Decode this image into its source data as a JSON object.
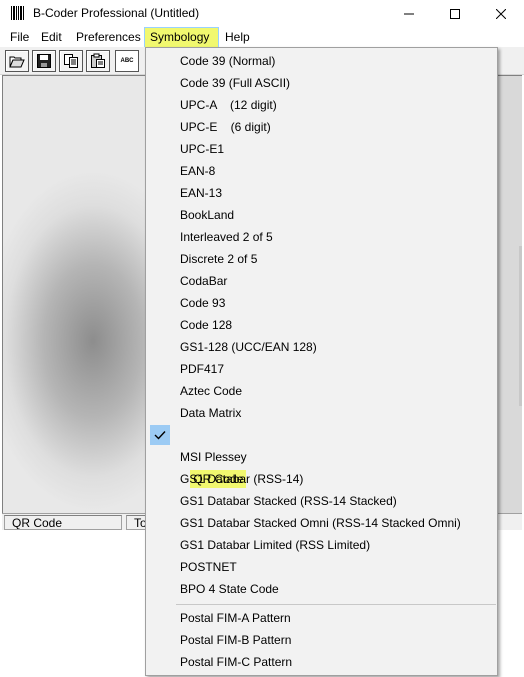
{
  "window": {
    "title": "B-Coder Professional (Untitled)",
    "icon": "barcode-icon"
  },
  "menubar": {
    "items": [
      {
        "label": "File"
      },
      {
        "label": "Edit"
      },
      {
        "label": "Preferences"
      },
      {
        "label": "Symbology",
        "active": true
      },
      {
        "label": "Help"
      }
    ]
  },
  "toolbar": {
    "buttons": [
      "open-icon",
      "save-icon",
      "copy-icon",
      "paste-icon"
    ],
    "text_button_label": "ABC"
  },
  "statusbar": {
    "symbology": "QR Code",
    "second": "To"
  },
  "symbology_menu": {
    "items": [
      {
        "label": "Code 39 (Normal)"
      },
      {
        "label": "Code 39 (Full ASCII)"
      },
      {
        "label": "UPC-A    (12 digit)"
      },
      {
        "label": "UPC-E    (6 digit)"
      },
      {
        "label": "UPC-E1"
      },
      {
        "label": "EAN-8"
      },
      {
        "label": "EAN-13"
      },
      {
        "label": "BookLand"
      },
      {
        "label": "Interleaved 2 of 5"
      },
      {
        "label": "Discrete 2 of 5"
      },
      {
        "label": "CodaBar"
      },
      {
        "label": "Code 93"
      },
      {
        "label": "Code 128"
      },
      {
        "label": "GS1-128 (UCC/EAN 128)"
      },
      {
        "label": "PDF417"
      },
      {
        "label": "Aztec Code"
      },
      {
        "label": "Data Matrix"
      },
      {
        "label": "QR Code",
        "checked": true
      },
      {
        "label": "MSI Plessey"
      },
      {
        "label": "GS1 Databar (RSS-14)"
      },
      {
        "label": "GS1 Databar Stacked (RSS-14 Stacked)"
      },
      {
        "label": "GS1 Databar Stacked Omni (RSS-14 Stacked Omni)"
      },
      {
        "label": "GS1 Databar Limited (RSS Limited)"
      },
      {
        "label": "POSTNET"
      },
      {
        "label": "BPO 4 State Code"
      }
    ],
    "pattern_items": [
      {
        "label": "Postal FIM-A Pattern"
      },
      {
        "label": "Postal FIM-B Pattern"
      },
      {
        "label": "Postal FIM-C Pattern"
      }
    ]
  },
  "colors": {
    "highlight": "#f1f86f",
    "check_bg": "#9ccbf4",
    "menu_bg": "#f2f2f2"
  }
}
